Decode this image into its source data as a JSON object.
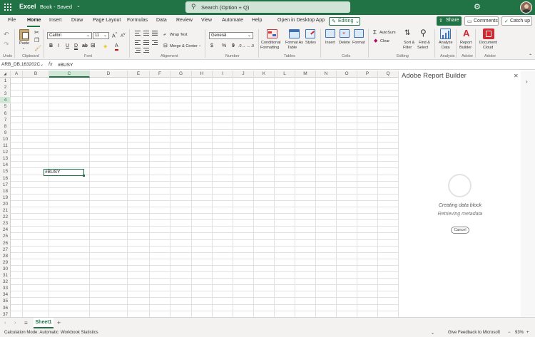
{
  "titlebar": {
    "app_name": "Excel",
    "doc_name": "Book - Saved",
    "search_placeholder": "Search (Option + Q)"
  },
  "tabs": [
    "File",
    "Home",
    "Insert",
    "Draw",
    "Page Layout",
    "Formulas",
    "Data",
    "Review",
    "View",
    "Automate",
    "Help",
    "Open in Desktop App"
  ],
  "active_tab": "Home",
  "buttons": {
    "editing": "Editing",
    "share": "Share",
    "comments": "Comments",
    "catch_up": "Catch up"
  },
  "ribbon": {
    "paste": "Paste",
    "font_name": "Calibri",
    "font_size": "11",
    "wrap_text": "Wrap Text",
    "merge_center": "Merge & Center",
    "number_format": "General",
    "currency": "$",
    "percent": "%",
    "comma": "9",
    "conditional_formatting": [
      "Conditional",
      "Formatting"
    ],
    "format_as_table": [
      "Format As",
      "Table"
    ],
    "styles": "Styles",
    "insert": "Insert",
    "delete": "Delete",
    "format": "Format",
    "autosum": "AutoSum",
    "clear": "Clear",
    "sort_filter": [
      "Sort &",
      "Filter"
    ],
    "find_select": [
      "Find &",
      "Select"
    ],
    "analyze_data": [
      "Analyze",
      "Data"
    ],
    "report_builder": [
      "Report",
      "Builder"
    ],
    "document_cloud": [
      "Document",
      "Cloud"
    ],
    "groups": [
      "Undo",
      "Clipboard",
      "Font",
      "Alignment",
      "Number",
      "Tables",
      "Cells",
      "Editing",
      "Analysis",
      "Adobe",
      "Adobe"
    ]
  },
  "formula_bar": {
    "name_box": "ARB_DB.163202C",
    "fx": "fx",
    "value": "#BUSY"
  },
  "grid": {
    "columns": [
      "A",
      "B",
      "C",
      "D",
      "E",
      "F",
      "G",
      "H",
      "I",
      "J",
      "K",
      "L",
      "M",
      "N",
      "O",
      "P",
      "Q"
    ],
    "rows": [
      "1",
      "2",
      "3",
      "4",
      "5",
      "6",
      "7",
      "8",
      "9",
      "10",
      "11",
      "12",
      "13",
      "14",
      "15",
      "16",
      "17",
      "18",
      "19",
      "20",
      "21",
      "22",
      "23",
      "24",
      "25",
      "26",
      "27",
      "28",
      "29",
      "30",
      "31",
      "32",
      "33",
      "34",
      "35",
      "36",
      "37"
    ],
    "selected_cell": "C4",
    "selected_value": "#BUSY"
  },
  "side_pane": {
    "title": "Adobe Report Builder",
    "status": "Creating data block",
    "substatus": "Retrieving metadata",
    "cancel": "Cancel"
  },
  "sheet_tabs": [
    "Sheet1"
  ],
  "status_bar": {
    "calculation_mode": "Calculation Mode: Automatic",
    "workbook_statistics": "Workbook Statistics",
    "feedback": "Give Feedback to Microsoft",
    "zoom": "93%"
  },
  "colors": {
    "brand": "#217346",
    "selection": "#d3e7d9",
    "adobe_red": "#d7262e"
  }
}
